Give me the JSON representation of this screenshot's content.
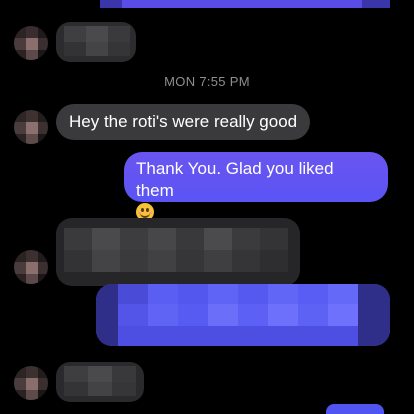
{
  "conversation": {
    "timestamp": "MON 7:55 PM",
    "messages": [
      {
        "direction": "incoming",
        "text": "Hey the roti's were really good"
      },
      {
        "direction": "outgoing",
        "text": "Thank You. Glad you liked them",
        "emoji": "smiling-face-icon"
      }
    ]
  },
  "colors": {
    "background": "#000000",
    "incoming_bubble": "#3a3a3c",
    "outgoing_bubble": "#5b54f4",
    "timestamp": "#8e8e93"
  }
}
